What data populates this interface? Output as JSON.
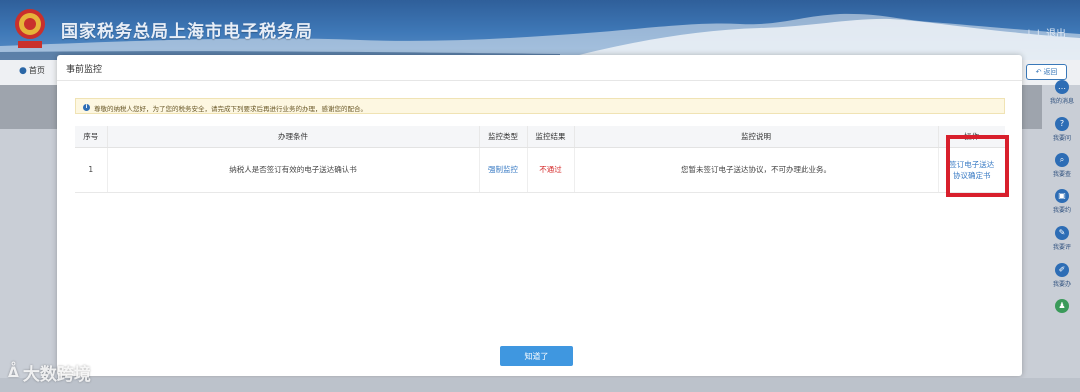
{
  "header": {
    "title": "国家税务总局上海市电子税务局",
    "divider": "|",
    "exit_label": "退出"
  },
  "nav": {
    "home_label": "首页",
    "back_label": "返回"
  },
  "modal": {
    "title": "事前监控",
    "notice": "尊敬的纳税人您好，为了您的税务安全，请完成下列要求后再进行业务的办理，感谢您的配合。",
    "columns": [
      "序号",
      "办理条件",
      "监控类型",
      "监控结果",
      "监控说明",
      "操作"
    ],
    "rows": [
      {
        "index": "1",
        "condition": "纳税人是否签订有效的电子送达确认书",
        "type": "强制监控",
        "result": "不通过",
        "description": "您暂未签订电子送达协议，不可办理此业务。",
        "action": "签订电子送达协议确定书"
      }
    ],
    "ok_label": "知道了"
  },
  "toolbar": [
    {
      "label": "我的消息",
      "icon": "message-icon",
      "glyph": "…"
    },
    {
      "label": "我要问",
      "icon": "question-icon",
      "glyph": "?"
    },
    {
      "label": "我要查",
      "icon": "search-icon",
      "glyph": "⌕"
    },
    {
      "label": "我要约",
      "icon": "calendar-icon",
      "glyph": "▣"
    },
    {
      "label": "我要评",
      "icon": "comment-icon",
      "glyph": "✎"
    },
    {
      "label": "我要办",
      "icon": "pen-icon",
      "glyph": "✐"
    },
    {
      "label": "",
      "icon": "robot-icon",
      "glyph": "♟"
    }
  ],
  "watermark": {
    "text": "大数跨境"
  },
  "colors": {
    "header_blue": "#3f79b8",
    "link_blue": "#3a7bc4",
    "fail_red": "#d42a2a",
    "highlight_red": "#d81f2c",
    "button_blue": "#3f97e0"
  }
}
